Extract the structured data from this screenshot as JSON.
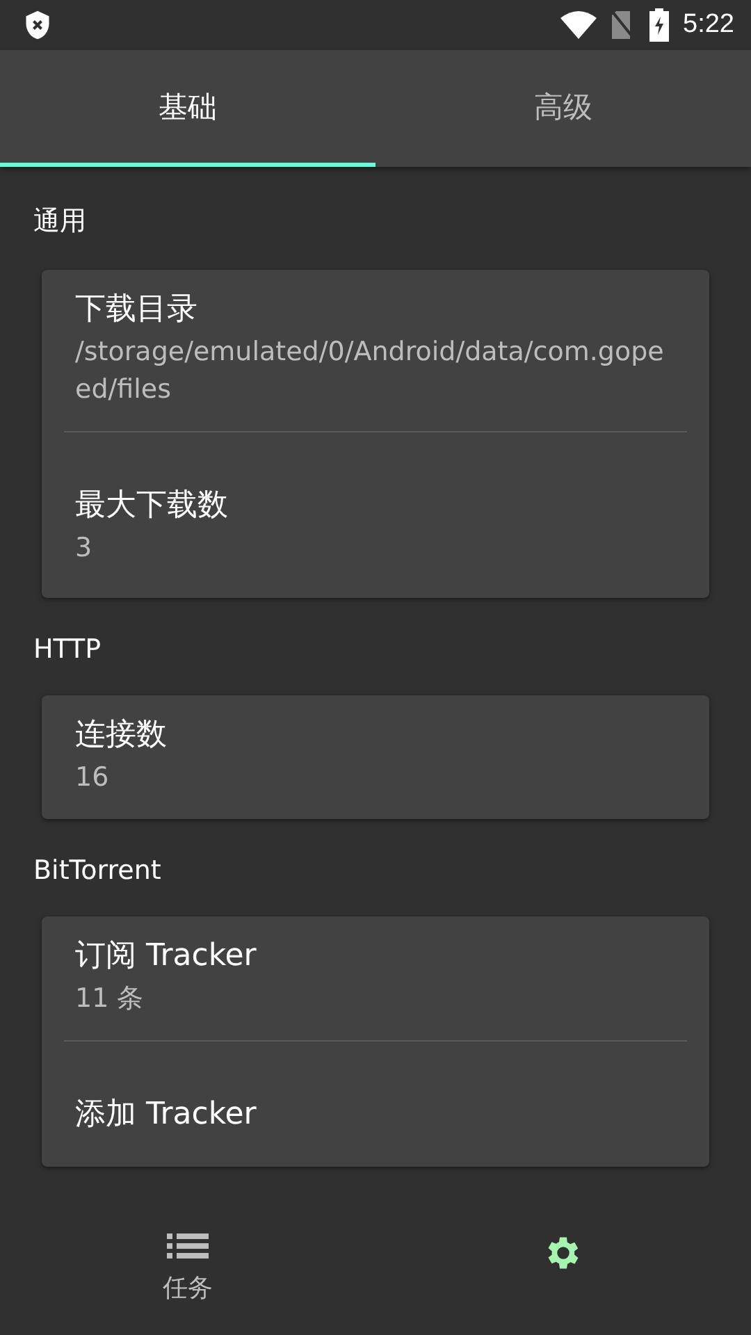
{
  "status_bar": {
    "time": "5:22"
  },
  "tabs": [
    {
      "label": "基础",
      "selected": true
    },
    {
      "label": "高级",
      "selected": false
    }
  ],
  "sections": [
    {
      "title": "通用",
      "items": [
        {
          "title": "下载目录",
          "value": "/storage/emulated/0/Android/data/com.gopeed/files"
        },
        {
          "title": "最大下载数",
          "value": "3"
        }
      ]
    },
    {
      "title": "HTTP",
      "items": [
        {
          "title": "连接数",
          "value": "16"
        }
      ]
    },
    {
      "title": "BitTorrent",
      "items": [
        {
          "title": "订阅 Tracker",
          "value": "11 条"
        },
        {
          "title": "添加 Tracker"
        }
      ]
    }
  ],
  "bottom_nav": [
    {
      "kind": "list",
      "label": "任务",
      "selected": false
    },
    {
      "kind": "settings",
      "selected": true
    }
  ]
}
